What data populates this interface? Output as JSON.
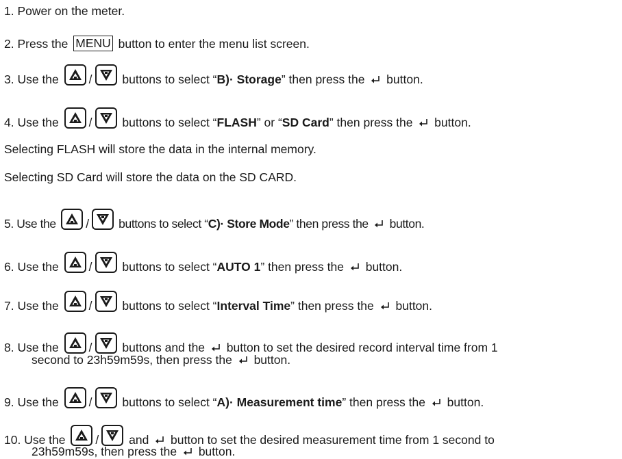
{
  "steps": {
    "s1": {
      "text": "1. Power on the meter."
    },
    "s2": {
      "a": "2. Press the ",
      "key": "MENU",
      "b": " button to enter the menu list screen."
    },
    "s3": {
      "a": "3. Use the ",
      "b": " buttons to select “",
      "bold": "B)· Storage",
      "c": "” then press the ",
      "d": " button."
    },
    "s4": {
      "a": "4. Use the ",
      "b": " buttons to select “",
      "bold1": "FLASH",
      "c": "” or “",
      "bold2": "SD Card",
      "d": "” then press the ",
      "e": " button."
    },
    "n1": {
      "text": "Selecting FLASH will store the data in the internal memory."
    },
    "n2": {
      "text": "Selecting SD Card will store the data on the SD CARD."
    },
    "s5": {
      "a": "5. Use the ",
      "b": " buttons to select “",
      "bold": "C)· Store Mode",
      "c": "” then press the ",
      "d": " button."
    },
    "s6": {
      "a": "6. Use the ",
      "b": " buttons to select “",
      "bold": "AUTO 1",
      "c": "” then press the ",
      "d": " button."
    },
    "s7": {
      "a": "7. Use the ",
      "b": " buttons to select “",
      "bold": "Interval Time",
      "c": "” then press the ",
      "d": " button."
    },
    "s8": {
      "a": "8. Use the ",
      "b": " buttons and the ",
      "c": " button to set the desired record interval time from 1",
      "cont_a": "second to 23h59m59s, then press the ",
      "cont_b": " button."
    },
    "s9": {
      "a": "9. Use the ",
      "b": " buttons to select “",
      "bold": "A)· Measurement time",
      "c": "” then press the ",
      "d": " button."
    },
    "s10": {
      "a": "10. Use the ",
      "b": " and ",
      "c": " button to set the desired measurement time from 1 second to",
      "cont_a": "23h59m59s, then press the ",
      "cont_b": " button."
    }
  },
  "slash": "/",
  "icons": {
    "up": "up-arrow-button-icon",
    "down": "down-arrow-button-icon",
    "enter": "enter-return-icon"
  },
  "colors": {
    "text": "#1a1a1a",
    "background": "#ffffff"
  }
}
